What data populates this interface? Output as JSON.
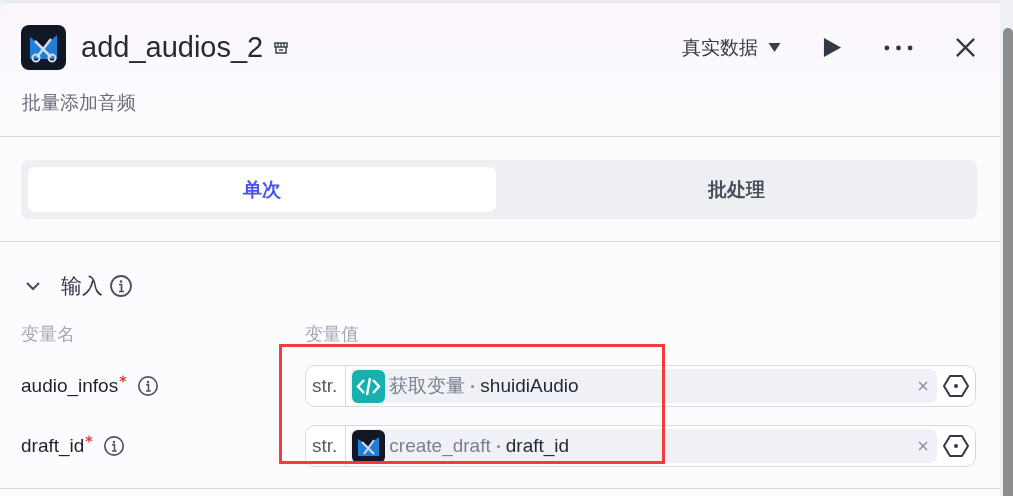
{
  "header": {
    "title": "add_audios_2",
    "subtitle": "批量添加音频",
    "data_mode": "真实数据"
  },
  "tabs": [
    {
      "label": "单次",
      "selected": true
    },
    {
      "label": "批处理",
      "selected": false
    }
  ],
  "input_section": {
    "title": "输入",
    "expanded": true,
    "columns": [
      "变量名",
      "变量值"
    ],
    "rows": [
      {
        "name": "audio_infos",
        "required": true,
        "type": "str.",
        "kind": "code",
        "source": "获取变量",
        "variable": "shuidiAudio"
      },
      {
        "name": "draft_id",
        "required": true,
        "type": "str.",
        "kind": "plugin",
        "source": "create_draft",
        "variable": "draft_id"
      }
    ]
  }
}
